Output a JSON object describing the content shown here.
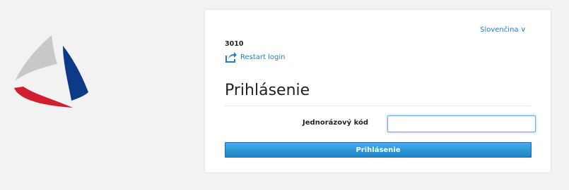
{
  "header": {
    "language_label": "Slovenčina ∨"
  },
  "session": {
    "username": "3010",
    "restart_label": "Restart login"
  },
  "form": {
    "title": "Prihlásenie",
    "otp_label": "Jednorázový kód",
    "otp_value": "",
    "otp_placeholder": "",
    "submit_label": "Prihlásenie"
  },
  "colors": {
    "link": "#1e7fc8",
    "button": "#1b82c8",
    "logo_gray": "#c8c8c8",
    "logo_red": "#d11f2f",
    "logo_blue": "#0c3a88"
  },
  "icons": {
    "restart": "share-arrow-icon",
    "logo": "tricolor-triangle-logo"
  }
}
